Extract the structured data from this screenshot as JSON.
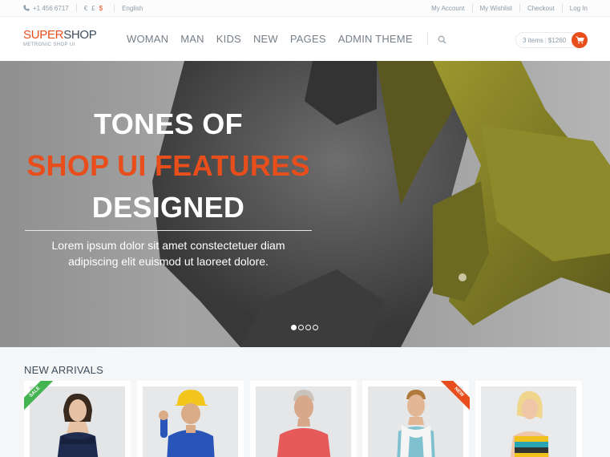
{
  "topbar": {
    "phone": "+1 456 6717",
    "currencies": [
      "€",
      "£",
      "$"
    ],
    "active_currency": "$",
    "language": "English",
    "links": [
      "My Account",
      "My Wishlist",
      "Checkout",
      "Log In"
    ]
  },
  "header": {
    "logo_part1": "SUPER",
    "logo_part2": "SHOP",
    "logo_tagline": "METRONIC SHOP UI",
    "nav": [
      "WOMAN",
      "MAN",
      "KIDS",
      "NEW",
      "PAGES",
      "ADMIN THEME"
    ],
    "cart_items": "3 items",
    "cart_total": "$1260"
  },
  "hero": {
    "line1": "TONES OF",
    "line2": "SHOP UI FEATURES",
    "line3": "DESIGNED",
    "subtitle_line1": "Lorem ipsum dolor sit amet constectetuer diam",
    "subtitle_line2": "adipiscing elit euismod ut laoreet dolore.",
    "slide_count": 4,
    "active_slide": 1
  },
  "arrivals": {
    "title": "NEW ARRIVALS",
    "sale_badge": "SALE",
    "new_badge": "NEW"
  },
  "colors": {
    "accent": "#e84d1c",
    "sale_green": "#44b352",
    "text_dark": "#3e4d5c",
    "text_muted": "#8c9aa7"
  }
}
